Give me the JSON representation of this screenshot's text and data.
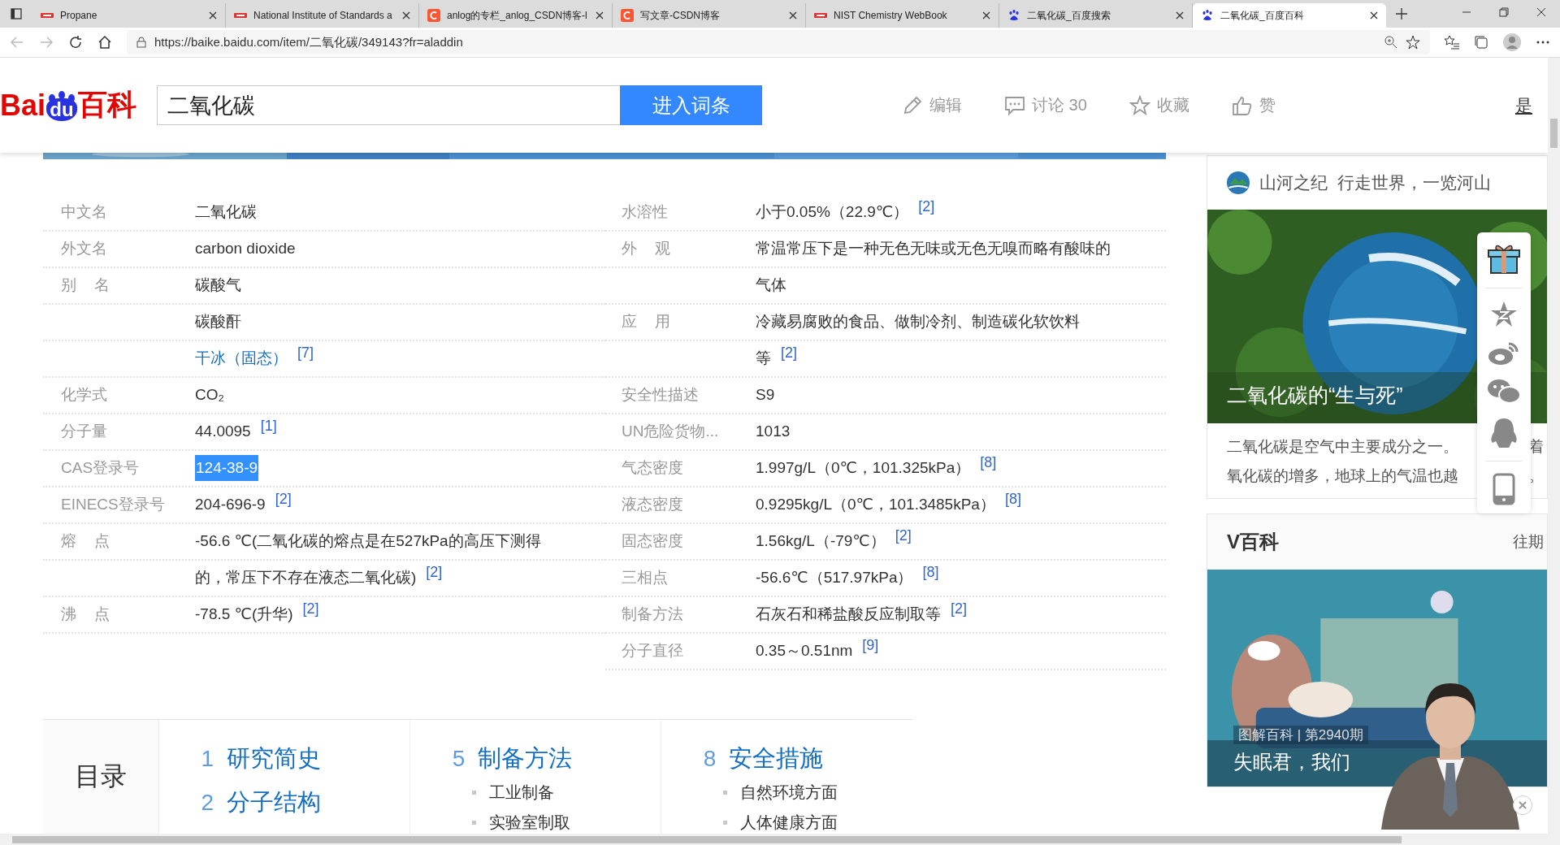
{
  "browser": {
    "tabs": [
      {
        "title": "Propane",
        "kind": "nist",
        "selected": false
      },
      {
        "title": "National Institute of Standards a",
        "kind": "nist",
        "selected": false
      },
      {
        "title": "anlog的专栏_anlog_CSDN博客-l",
        "kind": "csdn",
        "selected": false
      },
      {
        "title": "写文章-CSDN博客",
        "kind": "csdn",
        "selected": false
      },
      {
        "title": "NIST Chemistry WebBook",
        "kind": "nist",
        "selected": false
      },
      {
        "title": "二氧化碳_百度搜索",
        "kind": "baidu",
        "selected": false
      },
      {
        "title": "二氧化碳_百度百科",
        "kind": "baidu",
        "selected": true
      }
    ],
    "address": "https://baike.baidu.com/item/二氧化碳/349143?fr=aladdin"
  },
  "header": {
    "logo": [
      "Bai",
      "du",
      "百科"
    ],
    "search": {
      "value": "二氧化碳"
    },
    "search_button": "进入词条",
    "actions": [
      {
        "label": "编辑"
      },
      {
        "label": "讨论 30"
      },
      {
        "label": "收藏"
      },
      {
        "label": "赞"
      }
    ],
    "cut_link": "是"
  },
  "infobox": {
    "columns": [
      {
        "rows": [
          {
            "label": "中文名",
            "value": "二氧化碳",
            "link": false,
            "selected": false
          },
          {
            "label": "外文名",
            "value": "carbon dioxide",
            "link": false,
            "selected": false
          },
          {
            "label": "别 名",
            "value": "碳酸气",
            "link": false,
            "selected": false
          },
          {
            "value": "碳酸酐",
            "link": false,
            "selected": false
          },
          {
            "value": "干冰（固态）",
            "ref": "[7]",
            "link": true,
            "selected": false
          },
          {
            "label": "化学式",
            "value": "CO₂",
            "link": false,
            "selected": false
          },
          {
            "label": "分子量",
            "value": "44.0095",
            "ref": "[1]",
            "link": false,
            "selected": false
          },
          {
            "label": "CAS登录号",
            "value": "124-38-9",
            "link": false,
            "selected": true
          },
          {
            "label": "EINECS登录号",
            "value": "204-696-9",
            "ref": "[2]",
            "link": false,
            "selected": false
          },
          {
            "label": "熔 点",
            "value": "-56.6 ℃(二氧化碳的熔点是在527kPa的高压下测得",
            "link": false,
            "selected": false
          },
          {
            "value": "的，常压下不存在液态二氧化碳)",
            "ref": "[2]",
            "link": false,
            "selected": false
          },
          {
            "label": "沸 点",
            "value": "-78.5 ℃(升华)",
            "ref": "[2]",
            "link": false,
            "selected": false
          }
        ]
      },
      {
        "rows": [
          {
            "label": "水溶性",
            "value": "小于0.05%（22.9℃）",
            "ref": "[2]",
            "link": false,
            "selected": false
          },
          {
            "label": "外 观",
            "value": "常温常压下是一种无色无味或无色无嗅而略有酸味的",
            "link": false,
            "selected": false
          },
          {
            "value": "气体",
            "link": false,
            "selected": false
          },
          {
            "label": "应 用",
            "value": "冷藏易腐败的食品、做制冷剂、制造碳化软饮料",
            "link": false,
            "selected": false
          },
          {
            "value": "等",
            "ref": "[2]",
            "link": false,
            "selected": false
          },
          {
            "label": "安全性描述",
            "value": "S9",
            "link": false,
            "selected": false
          },
          {
            "label": "UN危险货物...",
            "value": "1013",
            "link": false,
            "selected": false
          },
          {
            "label": "气态密度",
            "value": "1.997g/L（0℃，101.325kPa）",
            "ref": "[8]",
            "link": false,
            "selected": false
          },
          {
            "label": "液态密度",
            "value": "0.9295kg/L（0℃，101.3485kPa）",
            "ref": "[8]",
            "link": false,
            "selected": false
          },
          {
            "label": "固态密度",
            "value": "1.56kg/L（-79℃）",
            "ref": "[2]",
            "link": false,
            "selected": false
          },
          {
            "label": "三相点",
            "value": "-56.6℃（517.97kPa）",
            "ref": "[8]",
            "link": false,
            "selected": false
          },
          {
            "label": "制备方法",
            "value": "石灰石和稀盐酸反应制取等",
            "ref": "[2]",
            "link": false,
            "selected": false
          },
          {
            "label": "分子直径",
            "value": "0.35～0.51nm",
            "ref": "[9]",
            "link": false,
            "selected": false
          }
        ]
      }
    ]
  },
  "toc": {
    "title": "目录",
    "columns": [
      {
        "items": [
          {
            "number": "1",
            "title": "研究简史"
          },
          {
            "number": "2",
            "title": "分子结构"
          }
        ]
      },
      {
        "items": [
          {
            "number": "5",
            "title": "制备方法",
            "children": [
              {
                "title": "工业制备"
              },
              {
                "title": "实验室制取"
              }
            ]
          }
        ]
      },
      {
        "items": [
          {
            "number": "8",
            "title": "安全措施",
            "children": [
              {
                "title": "自然环境方面"
              },
              {
                "title": "人体健康方面"
              }
            ]
          }
        ]
      }
    ]
  },
  "sidebar": {
    "feature": {
      "channel": "山河之纪",
      "slogan": "行走世界，一览河山",
      "caption": "二氧化碳的“生与死”",
      "lines": [
        [
          "二氧化碳是空气中主要成分之一。",
          "着"
        ],
        [
          "氧化碳的增多，地球上的气温也越",
          "。"
        ]
      ]
    },
    "vbaike": {
      "title": "V百科",
      "more": "往期",
      "captions": [
        "图解百科 | 第2940期",
        "失眠君，我们"
      ]
    }
  }
}
